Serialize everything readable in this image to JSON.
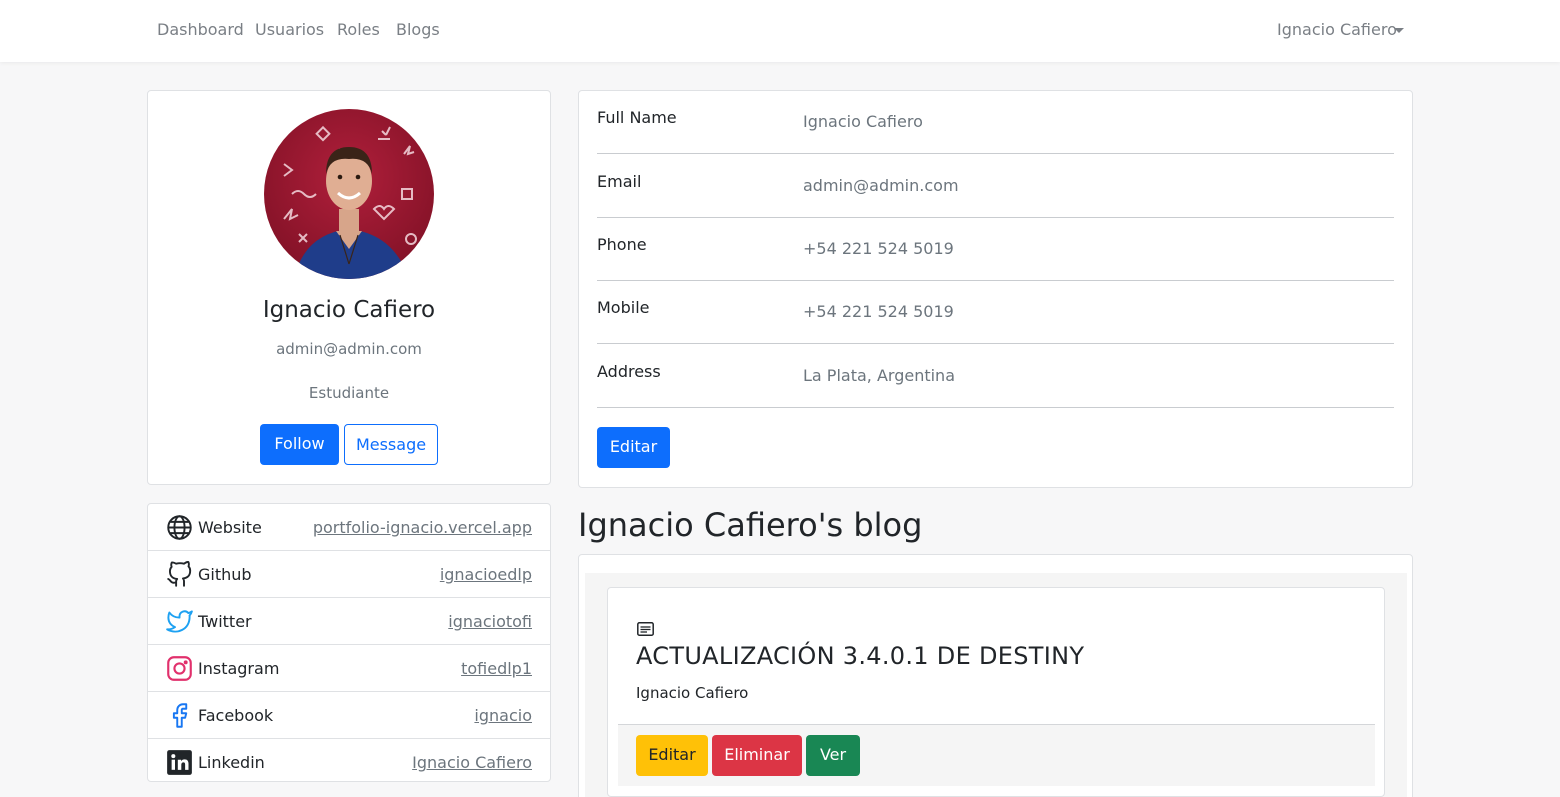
{
  "nav": {
    "links": [
      "Dashboard",
      "Usuarios",
      "Roles",
      "Blogs"
    ],
    "user": "Ignacio Cafiero"
  },
  "profile": {
    "name": "Ignacio Cafiero",
    "email": "admin@admin.com",
    "role": "Estudiante",
    "follow_label": "Follow",
    "message_label": "Message"
  },
  "social": [
    {
      "label": "Website",
      "value": "portfolio-ignacio.vercel.app",
      "icon": "globe-icon"
    },
    {
      "label": "Github",
      "value": "ignacioedlp",
      "icon": "github-icon"
    },
    {
      "label": "Twitter",
      "value": "ignaciotofi",
      "icon": "twitter-icon"
    },
    {
      "label": "Instagram",
      "value": "tofiedlp1",
      "icon": "instagram-icon"
    },
    {
      "label": "Facebook",
      "value": "ignacio",
      "icon": "facebook-icon"
    },
    {
      "label": "Linkedin",
      "value": "Ignacio Cafiero",
      "icon": "linkedin-icon"
    }
  ],
  "details": [
    {
      "label": "Full Name",
      "value": "Ignacio Cafiero"
    },
    {
      "label": "Email",
      "value": "admin@admin.com"
    },
    {
      "label": "Phone",
      "value": "+54 221 524 5019"
    },
    {
      "label": "Mobile",
      "value": "+54 221 524 5019"
    },
    {
      "label": "Address",
      "value": "La Plata, Argentina"
    }
  ],
  "edit_label": "Editar",
  "blog": {
    "heading": "Ignacio Cafiero's blog",
    "post": {
      "title": "ACTUALIZACIÓN 3.4.0.1 DE DESTINY",
      "author": "Ignacio Cafiero",
      "edit_label": "Editar",
      "delete_label": "Eliminar",
      "view_label": "Ver"
    }
  },
  "colors": {
    "primary": "#0d6efd",
    "warning": "#ffc107",
    "danger": "#dc3545",
    "success": "#198754",
    "twitter": "#1da1f2",
    "instagram": "#e1306c",
    "facebook": "#1877f2"
  }
}
